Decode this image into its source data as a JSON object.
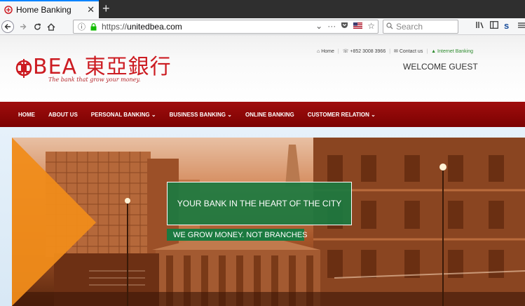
{
  "browser": {
    "tab_title": "Home Banking",
    "url_prefix": "https://",
    "url_domain": "unitedbea.com",
    "search_placeholder": "Search"
  },
  "site": {
    "logo_text": "BEA 東亞銀行",
    "tagline": "The bank that grow your money.",
    "top_links": {
      "home": "Home",
      "phone": "+852 3008 3966",
      "contact": "Contact us",
      "internet_banking": "Internet Banking"
    },
    "welcome": "WELCOME GUEST",
    "menu": [
      {
        "label": "HOME"
      },
      {
        "label": "ABOUT US"
      },
      {
        "label": "PERSONAL BANKING ⌄"
      },
      {
        "label": "BUSINESS BANKING ⌄"
      },
      {
        "label": "ONLINE BANKING"
      },
      {
        "label": "CUSTOMER RELATION ⌄"
      }
    ],
    "hero": {
      "title": "YOUR BANK IN THE HEART OF THE CITY",
      "subtitle": "WE GROW MONEY. NOT BRANCHES"
    }
  },
  "colors": {
    "menu_bg": "#8b0000",
    "brand_red": "#cc1c22",
    "banner_green": "#1b7a40",
    "accent_orange": "#f08c1a"
  }
}
